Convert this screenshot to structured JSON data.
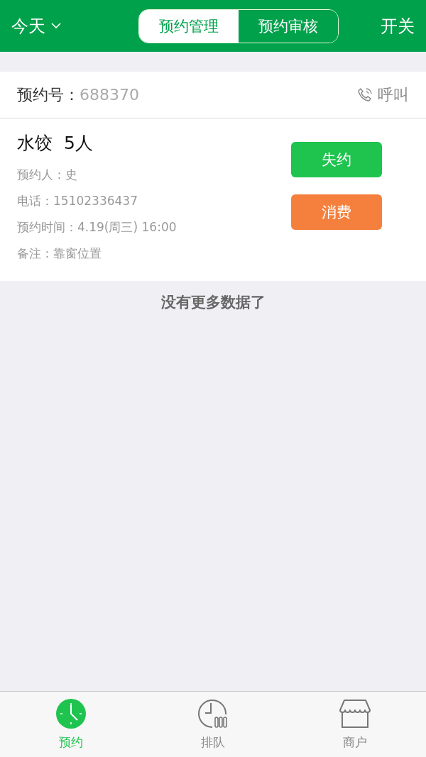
{
  "header": {
    "date_filter": "今天",
    "segments": [
      {
        "label": "预约管理",
        "selected": true
      },
      {
        "label": "预约审核",
        "selected": false
      }
    ],
    "action": "开关"
  },
  "reservation": {
    "number_label": "预约号：",
    "number": "688370",
    "call_label": "呼叫",
    "title": "水饺  5人",
    "details": [
      "预约人：史",
      "电话：15102336437",
      "预约时间：4.19(周三) 16:00",
      "备注：靠窗位置"
    ],
    "buttons": [
      {
        "label": "失约",
        "color": "#1fc44f"
      },
      {
        "label": "消费",
        "color": "#f5803e"
      }
    ]
  },
  "end_message": "没有更多数据了",
  "tab_bar": [
    {
      "label": "预约",
      "selected": true
    },
    {
      "label": "排队",
      "selected": false
    },
    {
      "label": "商户",
      "selected": false
    }
  ]
}
